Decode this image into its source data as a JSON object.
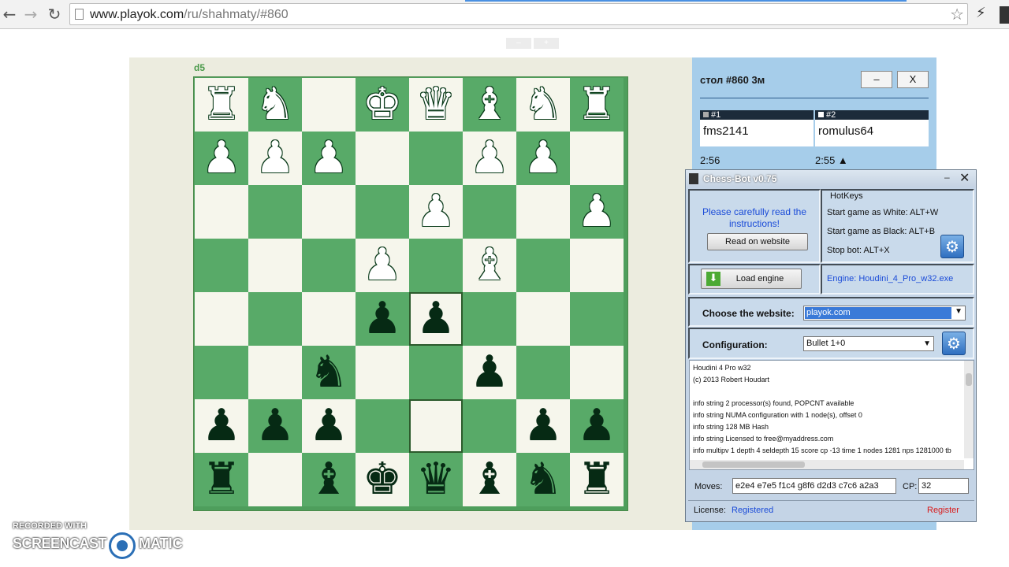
{
  "browser": {
    "url_host": "www.playok.com",
    "url_path": "/ru/shahmaty/#860",
    "back_icon": "back-arrow-icon",
    "forward_icon": "forward-arrow-icon",
    "reload_icon": "reload-icon",
    "star_icon": "bookmark-star-icon",
    "extension_icon": "lightning-icon"
  },
  "page": {
    "zoom_minus": "–",
    "zoom_plus": "+",
    "last_move": "d5"
  },
  "board": {
    "light_color": "#f6f6ec",
    "dark_color": "#58aa68",
    "highlight": "d5",
    "ranks": [
      [
        "wR",
        "wN",
        "",
        "wK",
        "wQ",
        "wB",
        "wN",
        "wR"
      ],
      [
        "wP",
        "wP",
        "wP",
        "",
        "",
        "wP",
        "wP",
        ""
      ],
      [
        "",
        "",
        "",
        "",
        "wP",
        "",
        "",
        "wP"
      ],
      [
        "",
        "",
        "",
        "wP",
        "",
        "wB",
        "",
        ""
      ],
      [
        "",
        "",
        "",
        "bP",
        "bP",
        "",
        "",
        ""
      ],
      [
        "",
        "",
        "bN",
        "",
        "",
        "bP",
        "",
        ""
      ],
      [
        "bP",
        "bP",
        "bP",
        "",
        "",
        "",
        "bP",
        "bP"
      ],
      [
        "bR",
        "",
        "bB",
        "bK",
        "bQ",
        "bB",
        "bN",
        "bR"
      ]
    ]
  },
  "table": {
    "title": "стол #860   3м",
    "minimize": "–",
    "close": "X",
    "seat1_label": "#1",
    "seat2_label": "#2",
    "player1": "fms2141",
    "player2": "romulus64",
    "clock1": "2:56",
    "clock2": "2:55 ▲"
  },
  "bot": {
    "title": "Chess-Bot v0.75",
    "minimize": "–",
    "close": "✕",
    "instructions": "Please carefully read the instructions!",
    "read_button": "Read on website",
    "hotkeys_title": "HotKeys",
    "hotkey_white": "Start game as White: ALT+W",
    "hotkey_black": "Start game as Black: ALT+B",
    "hotkey_stop": "Stop bot: ALT+X",
    "load_engine": "Load engine",
    "engine": "Engine: Houdini_4_Pro_w32.exe",
    "website_label": "Choose the website:",
    "website_value": "playok.com",
    "config_label": "Configuration:",
    "config_value": "Bullet 1+0",
    "log": [
      "Houdini 4 Pro w32",
      "(c) 2013 Robert Houdart",
      "",
      "info string 2 processor(s) found, POPCNT available",
      "info string NUMA configuration with 1 node(s), offset 0",
      "info string 128 MB Hash",
      "info string Licensed to free@myaddress.com",
      "info multipv 1 depth 4 seldepth 15 score cp -13 time 1 nodes 1281 nps 1281000 tb"
    ],
    "moves_label": "Moves:",
    "moves_value": "e2e4 e7e5 f1c4 g8f6 d2d3 c7c6 a2a3",
    "cp_label": "CP:",
    "cp_value": "32",
    "license_label": "License:",
    "license_value": "Registered",
    "register_link": "Register",
    "accent_blue": "#1a4bd8",
    "register_red": "#d81a1a"
  },
  "watermark": {
    "line1": "RECORDED WITH",
    "left": "SCREENCAST",
    "right": "MATIC"
  }
}
